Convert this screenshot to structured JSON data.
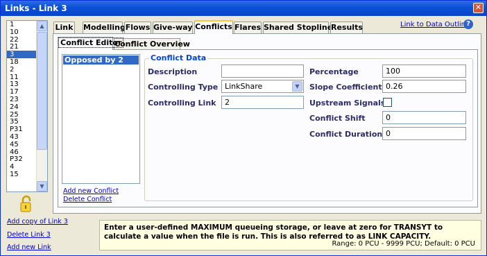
{
  "window": {
    "title": "Links - Link 3",
    "close_label": "✕"
  },
  "link_list": {
    "items": [
      "1",
      "10",
      "22",
      "21",
      "3",
      "18",
      "2",
      "11",
      "13",
      "17",
      "23",
      "24",
      "25",
      "35",
      "P31",
      "43",
      "45",
      "46",
      "P32",
      "4",
      "15"
    ],
    "selected": "3"
  },
  "left_links": {
    "add_copy": "Add copy of Link 3",
    "delete": "Delete Link 3",
    "add_new": "Add new Link"
  },
  "tabs": [
    {
      "label": "Link",
      "active": false
    },
    {
      "label": "Modelling",
      "active": false
    },
    {
      "label": "Flows",
      "active": false
    },
    {
      "label": "Give-way",
      "active": false
    },
    {
      "label": "Conflicts",
      "active": true
    },
    {
      "label": "Flares",
      "active": false
    },
    {
      "label": "Shared Stoplines",
      "active": false
    },
    {
      "label": "Results",
      "active": false
    }
  ],
  "link_to_data_outline": "Link to Data Outline",
  "help_icon": "?",
  "subtabs": [
    {
      "label": "Conflict Editor",
      "active": true
    },
    {
      "label": "Conflict Overview",
      "active": false
    }
  ],
  "conflicts": {
    "items": [
      "Opposed by 2"
    ],
    "add_label": "Add new Conflict",
    "delete_label": "Delete Conflict"
  },
  "conflict_data": {
    "title": "Conflict Data",
    "description": {
      "label": "Description",
      "value": ""
    },
    "controlling_type": {
      "label": "Controlling Type",
      "value": "LinkShare"
    },
    "controlling_link": {
      "label": "Controlling Link",
      "value": "2"
    },
    "percentage": {
      "label": "Percentage",
      "value": "100"
    },
    "slope_coefficient": {
      "label": "Slope Coefficient",
      "value": "0.26"
    },
    "upstream_signals": {
      "label": "Upstream Signals",
      "checked": false
    },
    "conflict_shift": {
      "label": "Conflict Shift",
      "value": "0"
    },
    "conflict_duration": {
      "label": "Conflict Duration",
      "value": "0"
    }
  },
  "help": {
    "text": "Enter a user-defined MAXIMUM queueing storage, or leave at zero for TRANSYT to calculate a value when the file is run.  This is also referred to as LINK CAPACITY.",
    "range": "Range: 0 PCU - 9999 PCU; Default: 0 PCU"
  },
  "colors": {
    "title_bar": "#0A4FD8",
    "selection": "#316AC5",
    "active_tab_accent": "#FFC83C",
    "help_background": "#FFFFE1",
    "link": "#0000CC"
  }
}
